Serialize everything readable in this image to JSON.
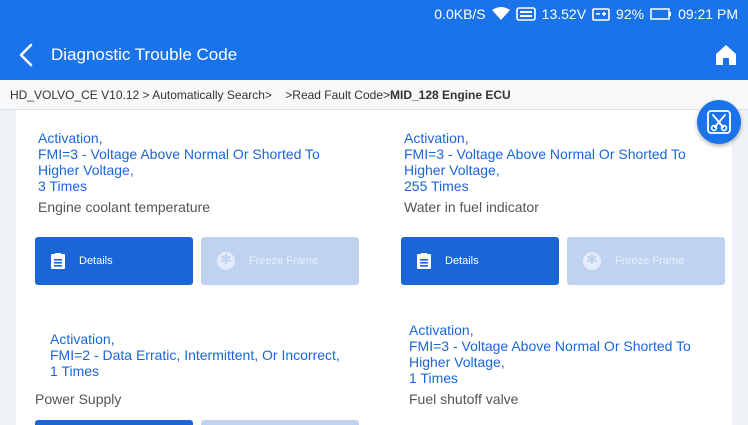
{
  "status": {
    "speed": "0.0KB/S",
    "voltage": "13.52V",
    "battery": "92%",
    "time": "09:21 PM"
  },
  "header": {
    "title": "Diagnostic Trouble Code"
  },
  "breadcrumb": {
    "path": "HD_VOLVO_CE V10.12 > Automatically Search>",
    "sub": ">Read Fault Code>",
    "current": "MID_128 Engine ECU"
  },
  "buttons": {
    "details": "Details",
    "freeze": "Freeze Frame"
  },
  "faults": [
    {
      "status": "Activation,",
      "fmi": "FMI=3 - Voltage Above Normal Or Shorted To Higher Voltage,",
      "times": "3 Times",
      "description": "Engine coolant temperature"
    },
    {
      "status": "Activation,",
      "fmi": "FMI=3 - Voltage Above Normal Or Shorted To Higher Voltage,",
      "times": "255 Times",
      "description": "Water in fuel indicator"
    },
    {
      "status": "Activation,",
      "fmi": "FMI=2 - Data Erratic, Intermittent, Or Incorrect,",
      "times": "1 Times",
      "description": "Power Supply"
    },
    {
      "status": "Activation,",
      "fmi": "FMI=3 - Voltage Above Normal Or Shorted To Higher Voltage,",
      "times": "1 Times",
      "description": "Fuel shutoff valve"
    }
  ]
}
